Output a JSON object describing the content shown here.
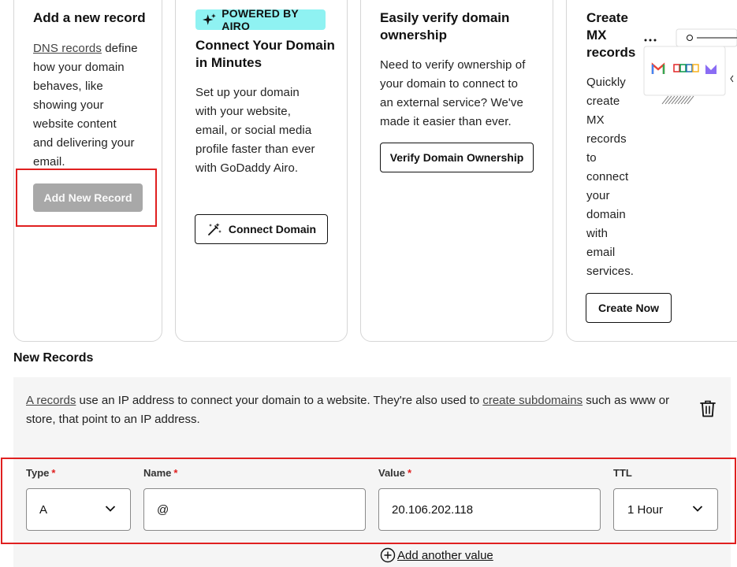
{
  "cards": {
    "add_record": {
      "title": "Add a new record",
      "link": "DNS records",
      "desc_l1_rest": " define",
      "desc_lines": [
        "how your domain",
        "behaves, like",
        "showing your",
        "website content",
        "and delivering your",
        "email."
      ],
      "button": "Add New Record"
    },
    "connect": {
      "badge": "POWERED BY AIRO",
      "title_lines": [
        "Connect Your Domain",
        "in Minutes"
      ],
      "desc_lines": [
        "Set up your domain",
        "with your website,",
        "email, or social media",
        "profile faster than ever",
        "with GoDaddy Airo."
      ],
      "button": "Connect Domain"
    },
    "verify": {
      "title_lines": [
        "Easily verify domain",
        "ownership"
      ],
      "desc_lines": [
        "Need to verify ownership of",
        "your domain to connect to",
        "an external service? We've",
        "made it easier than ever."
      ],
      "button": "Verify Domain Ownership"
    },
    "mx": {
      "title_lines": [
        "Create",
        "MX",
        "records"
      ],
      "desc_lines": [
        "Quickly",
        "create",
        "MX",
        "records",
        "to",
        "connect",
        "your",
        "domain",
        "with",
        "email",
        "services."
      ],
      "button": "Create Now"
    }
  },
  "new_records": {
    "title": "New Records",
    "info_link1": "A records",
    "info_text1": " use an IP address to connect your domain to a website. They're also used to ",
    "info_link2": "create subdomains",
    "info_text2": " such as www or store, that point to an IP address.",
    "fields": {
      "type_label": "Type",
      "type_value": "A",
      "name_label": "Name",
      "name_value": "@",
      "value_label": "Value",
      "value_value": "20.106.202.118",
      "ttl_label": "TTL",
      "ttl_value": "1 Hour",
      "required_mark": "*"
    },
    "add_value": "Add another value"
  },
  "colors": {
    "highlight": "#e02020",
    "airo_badge": "#8ff2f2",
    "panel_bg": "#f5f5f5",
    "disabled_button": "#a8a8a8"
  }
}
